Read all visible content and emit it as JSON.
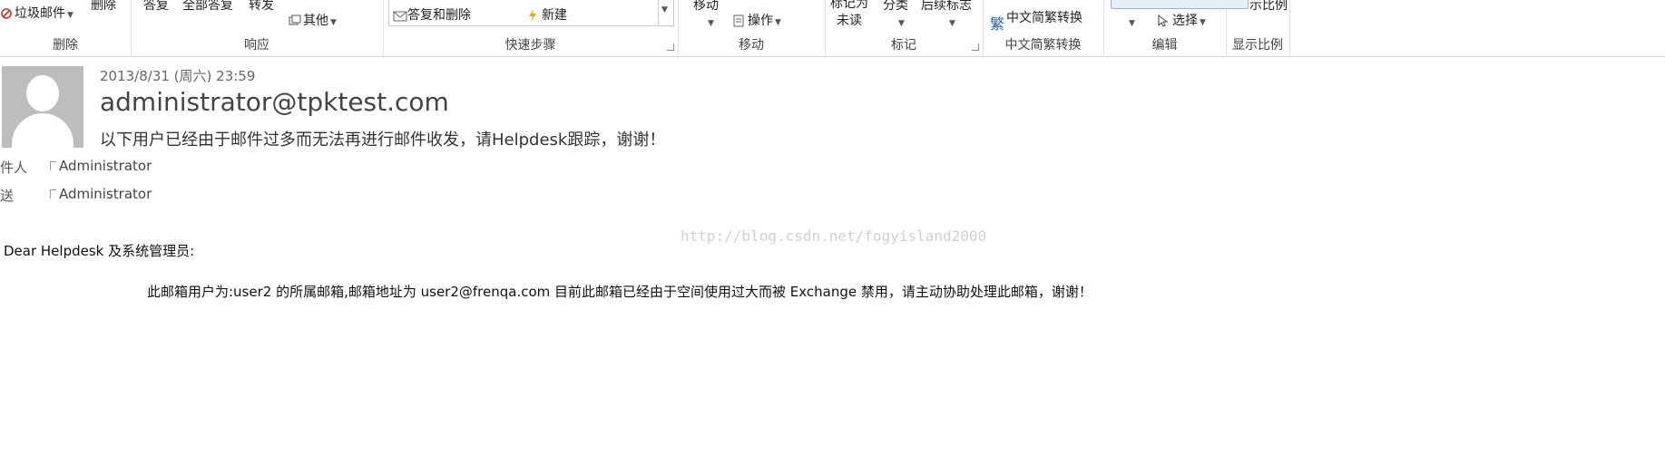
{
  "ribbon": {
    "delete_group": {
      "junk_label": "垃圾邮件",
      "delete_label": "删除",
      "group_label": "删除"
    },
    "respond_group": {
      "reply_label": "答复",
      "reply_all_label": "全部答复",
      "forward_label": "转发",
      "more_label": "其他",
      "group_label": "响应"
    },
    "quicksteps_group": {
      "reply_delete_label": "答复和删除",
      "new_label": "新建",
      "group_label": "快速步骤"
    },
    "move_group": {
      "move_label": "移动",
      "actions_label": "操作",
      "group_label": "移动"
    },
    "tags_group": {
      "mark_unread_line1": "标记为",
      "mark_unread_line2": "未读",
      "categorize_label": "分类",
      "followup_label": "后续标志",
      "group_label": "标记"
    },
    "chinese_group": {
      "convert_label": "中文简繁转换",
      "group_label": "中文简繁转换"
    },
    "editing_group": {
      "select_label": "选择",
      "group_label": "编辑"
    },
    "zoom_group": {
      "zoom_label": "示比例",
      "group_label": "显示比例"
    }
  },
  "message": {
    "date": "2013/8/31 (周六) 23:59",
    "sender": "administrator@tpktest.com",
    "subject": "以下用户已经由于邮件过多而无法再进行邮件收发，请Helpdesk跟踪，谢谢！",
    "to_label": "收件人",
    "to_value": "Administrator",
    "cc_label": "抄送",
    "cc_value": "Administrator",
    "greeting": "Dear Helpdesk 及系统管理员:",
    "body": "此邮箱用户为:user2 的所属邮箱,邮箱地址为 user2@frenqa.com 目前此邮箱已经由于空间使用过大而被 Exchange 禁用，请主动协助处理此邮箱，谢谢！",
    "watermark": "http://blog.csdn.net/fogyisland2000"
  },
  "colors": {
    "ribbon_bg": "#ffffff",
    "avatar_bg": "#bdbdbd",
    "watermark": "#d0d0d0"
  }
}
